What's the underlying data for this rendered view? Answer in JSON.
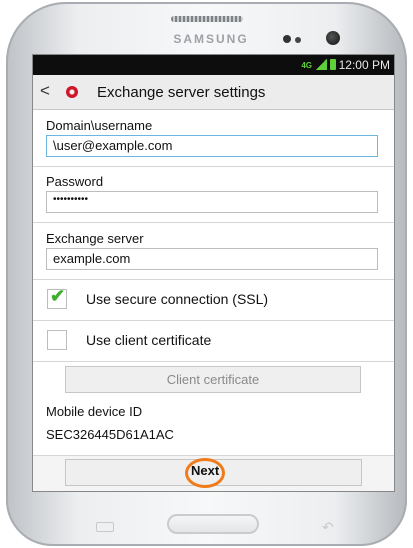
{
  "device": {
    "brand": "SAMSUNG"
  },
  "status_bar": {
    "network": "4G",
    "time": "12:00 PM"
  },
  "title_bar": {
    "back_glyph": "<",
    "title": "Exchange server settings"
  },
  "domain_username": {
    "label": "Domain\\username",
    "value": "\\user@example.com"
  },
  "password": {
    "label": "Password",
    "value": "••••••••••"
  },
  "exchange_server": {
    "label": "Exchange server",
    "value": "example.com"
  },
  "use_ssl": {
    "label": "Use secure connection (SSL)",
    "checked": true,
    "checkmark": "✔"
  },
  "use_client_cert": {
    "label": "Use client certificate",
    "checked": false
  },
  "client_certificate_button": {
    "label": "Client certificate"
  },
  "mobile_device_id": {
    "label": "Mobile device ID",
    "value": "SEC326445D61A1AC"
  },
  "next_button": {
    "label": "Next"
  },
  "hardware_keys": {
    "back_glyph": "↶"
  },
  "colors": {
    "ssl_check": "#3fae2a",
    "highlight_ring": "#ef7b1b",
    "app_icon": "#d0152a"
  }
}
